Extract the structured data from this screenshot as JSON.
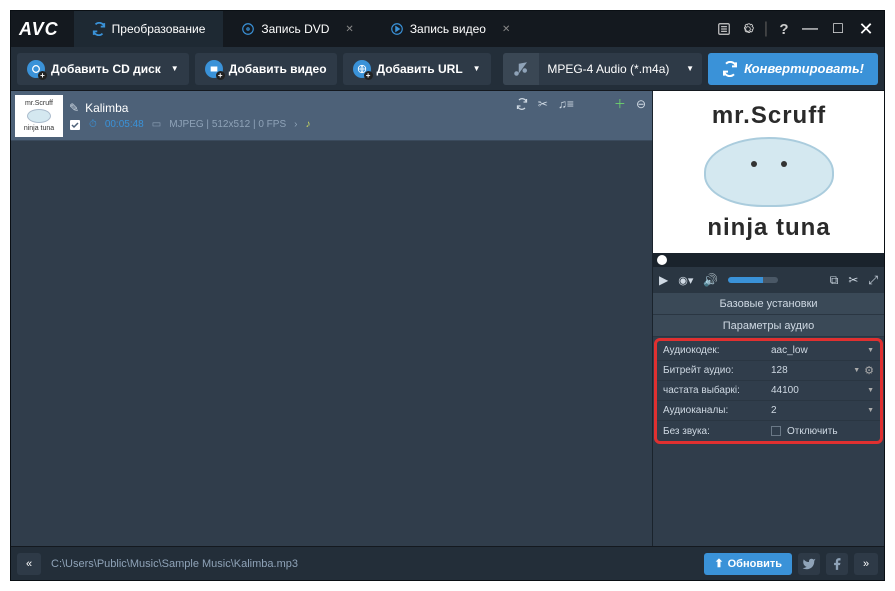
{
  "app": {
    "logo": "AVC"
  },
  "tabs": [
    {
      "label": "Преобразование",
      "active": true
    },
    {
      "label": "Запись DVD",
      "active": false
    },
    {
      "label": "Запись видео",
      "active": false
    }
  ],
  "toolbar": {
    "add_cd": "Добавить CD диск",
    "add_video": "Добавить видео",
    "add_url": "Добавить URL",
    "format": "MPEG-4 Audio (*.m4a)",
    "convert": "Конвертировать!"
  },
  "file": {
    "title": "Kalimba",
    "duration": "00:05:48",
    "codec": "MJPEG",
    "resolution": "512x512",
    "fps": "0 FPS",
    "thumb_top": "mr.Scruff",
    "thumb_bot": "ninja tuna"
  },
  "album": {
    "top": "mr.Scruff",
    "bot": "ninja tuna"
  },
  "settings": {
    "basic_header": "Базовые установки",
    "audio_header": "Параметры аудио",
    "rows": {
      "codec_label": "Аудиокодек:",
      "codec_value": "aac_low",
      "bitrate_label": "Битрейт аудио:",
      "bitrate_value": "128",
      "samplerate_label": "частата выбаркі:",
      "samplerate_value": "44100",
      "channels_label": "Аудиоканалы:",
      "channels_value": "2",
      "mute_label": "Без звука:",
      "mute_value": "Отключить"
    }
  },
  "status": {
    "path": "C:\\Users\\Public\\Music\\Sample Music\\Kalimba.mp3",
    "update": "Обновить"
  }
}
